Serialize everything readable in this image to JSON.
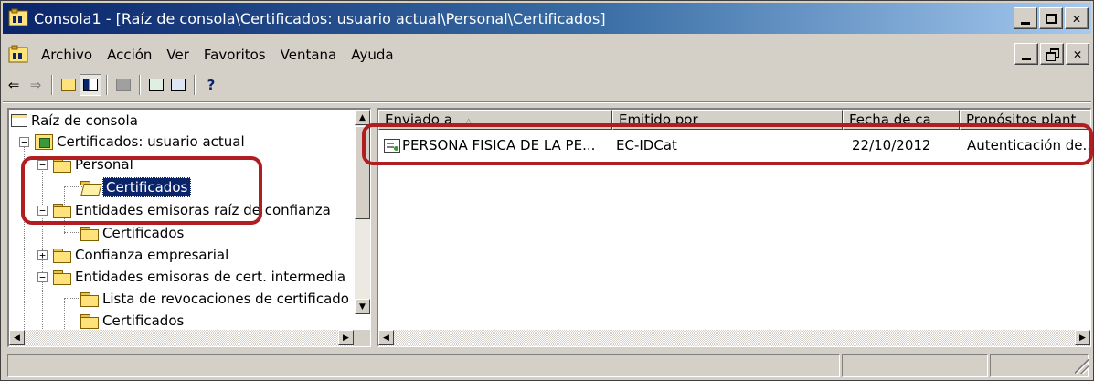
{
  "window": {
    "title": "Consola1 - [Raíz de consola\\Certificados: usuario actual\\Personal\\Certificados]",
    "app_icon": "mmc-console-icon"
  },
  "menubar": {
    "items": [
      {
        "label": "Archivo"
      },
      {
        "label": "Acción"
      },
      {
        "label": "Ver"
      },
      {
        "label": "Favoritos"
      },
      {
        "label": "Ventana"
      },
      {
        "label": "Ayuda"
      }
    ]
  },
  "toolbar": {
    "buttons": [
      "back-arrow-icon",
      "forward-arrow-icon",
      "up-folder-icon",
      "show-hide-tree-icon",
      "delete-icon",
      "refresh-icon",
      "export-list-icon",
      "help-icon"
    ]
  },
  "tree": {
    "nodes": [
      {
        "label": "Raíz de consola"
      },
      {
        "label": "Certificados: usuario actual"
      },
      {
        "label": "Personal"
      },
      {
        "label": "Certificados"
      },
      {
        "label": "Entidades emisoras raíz de confianza"
      },
      {
        "label": "Certificados"
      },
      {
        "label": "Confianza empresarial"
      },
      {
        "label": "Entidades emisoras de cert. intermedia"
      },
      {
        "label": "Lista de revocaciones de certificado"
      },
      {
        "label": "Certificados"
      }
    ],
    "selected_index": 3
  },
  "list": {
    "columns": [
      {
        "label": "Enviado a"
      },
      {
        "label": "Emitido por"
      },
      {
        "label": "Fecha de ca"
      },
      {
        "label": "Propósitos plant"
      }
    ],
    "rows": [
      {
        "enviado_a": "PERSONA FISICA DE LA PE...",
        "emitido_por": "EC-IDCat",
        "fecha": "22/10/2012",
        "propositos": "Autenticación de.."
      }
    ]
  },
  "colors": {
    "highlight": "#b01e22",
    "selection": "#0a246a",
    "titlebar_start": "#0a246a",
    "titlebar_end": "#a6caf0"
  }
}
